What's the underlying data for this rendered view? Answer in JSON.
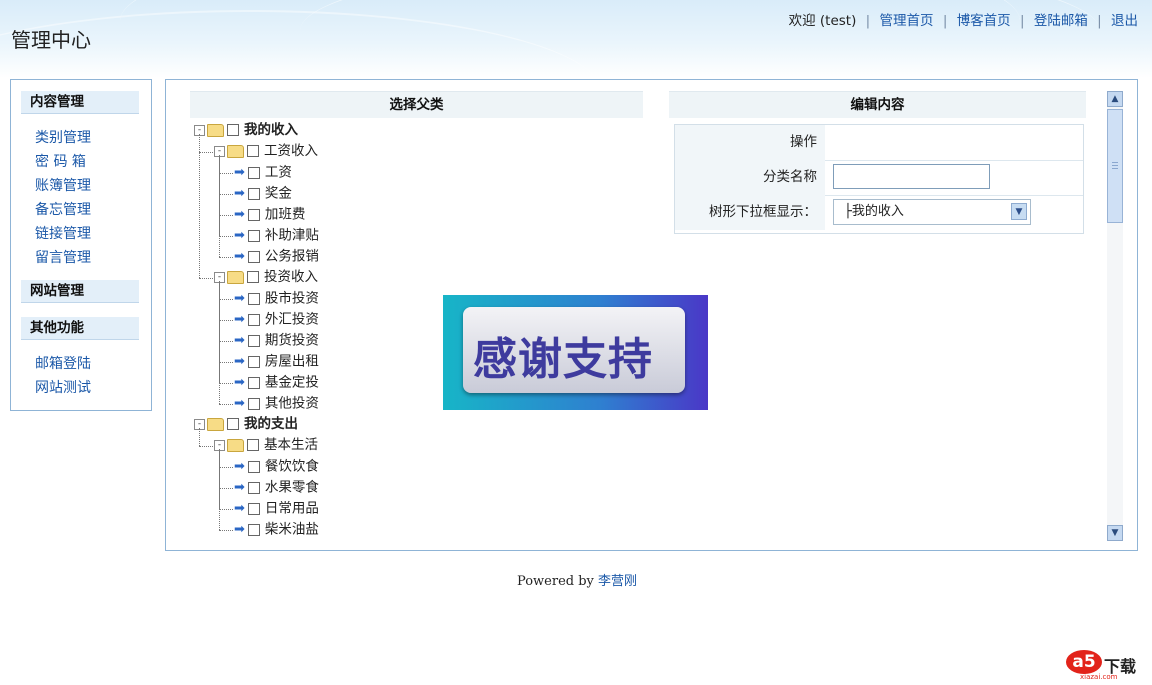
{
  "header": {
    "site_title": "管理中心",
    "welcome": "欢迎 (test)",
    "links": [
      "管理首页",
      "博客首页",
      "登陆邮箱",
      "退出"
    ]
  },
  "sidebar": {
    "sections": [
      {
        "title": "内容管理",
        "items": [
          "类别管理",
          "密 码 箱",
          "账簿管理",
          "备忘管理",
          "链接管理",
          "留言管理"
        ]
      },
      {
        "title": "网站管理",
        "items": []
      },
      {
        "title": "其他功能",
        "items": [
          "邮箱登陆",
          "网站测试"
        ]
      }
    ]
  },
  "tree_panel": {
    "title": "选择父类",
    "nodes": [
      {
        "label": "我的收入",
        "level": 0,
        "type": "folder"
      },
      {
        "label": "工资收入",
        "level": 1,
        "type": "folder"
      },
      {
        "label": "工资",
        "level": 2,
        "type": "leaf"
      },
      {
        "label": "奖金",
        "level": 2,
        "type": "leaf"
      },
      {
        "label": "加班费",
        "level": 2,
        "type": "leaf"
      },
      {
        "label": "补助津贴",
        "level": 2,
        "type": "leaf"
      },
      {
        "label": "公务报销",
        "level": 2,
        "type": "leaf"
      },
      {
        "label": "投资收入",
        "level": 1,
        "type": "folder"
      },
      {
        "label": "股市投资",
        "level": 2,
        "type": "leaf"
      },
      {
        "label": "外汇投资",
        "level": 2,
        "type": "leaf"
      },
      {
        "label": "期货投资",
        "level": 2,
        "type": "leaf"
      },
      {
        "label": "房屋出租",
        "level": 2,
        "type": "leaf"
      },
      {
        "label": "基金定投",
        "level": 2,
        "type": "leaf"
      },
      {
        "label": "其他投资",
        "level": 2,
        "type": "leaf"
      },
      {
        "label": "我的支出",
        "level": 0,
        "type": "folder"
      },
      {
        "label": "基本生活",
        "level": 1,
        "type": "folder"
      },
      {
        "label": "餐饮饮食",
        "level": 2,
        "type": "leaf"
      },
      {
        "label": "水果零食",
        "level": 2,
        "type": "leaf"
      },
      {
        "label": "日常用品",
        "level": 2,
        "type": "leaf"
      },
      {
        "label": "柴米油盐",
        "level": 2,
        "type": "leaf"
      }
    ]
  },
  "edit_panel": {
    "title": "编辑内容",
    "rows": [
      {
        "label": "操作",
        "kind": "text",
        "value": ""
      },
      {
        "label": "分类名称",
        "kind": "input",
        "value": ""
      },
      {
        "label": "树形下拉框显示：",
        "kind": "select",
        "value": "├我的收入"
      }
    ]
  },
  "ad": {
    "text": "感谢支持"
  },
  "footer": {
    "prefix": "Powered by",
    "author": "李营刚"
  },
  "watermark": {
    "logo": "a5",
    "text": "下载",
    "sub": "xiazai.com"
  },
  "colors": {
    "link": "#1b58a8",
    "border": "#8fb4d6",
    "panel_head": "#eef4f7",
    "folder": "#f7dc86"
  }
}
